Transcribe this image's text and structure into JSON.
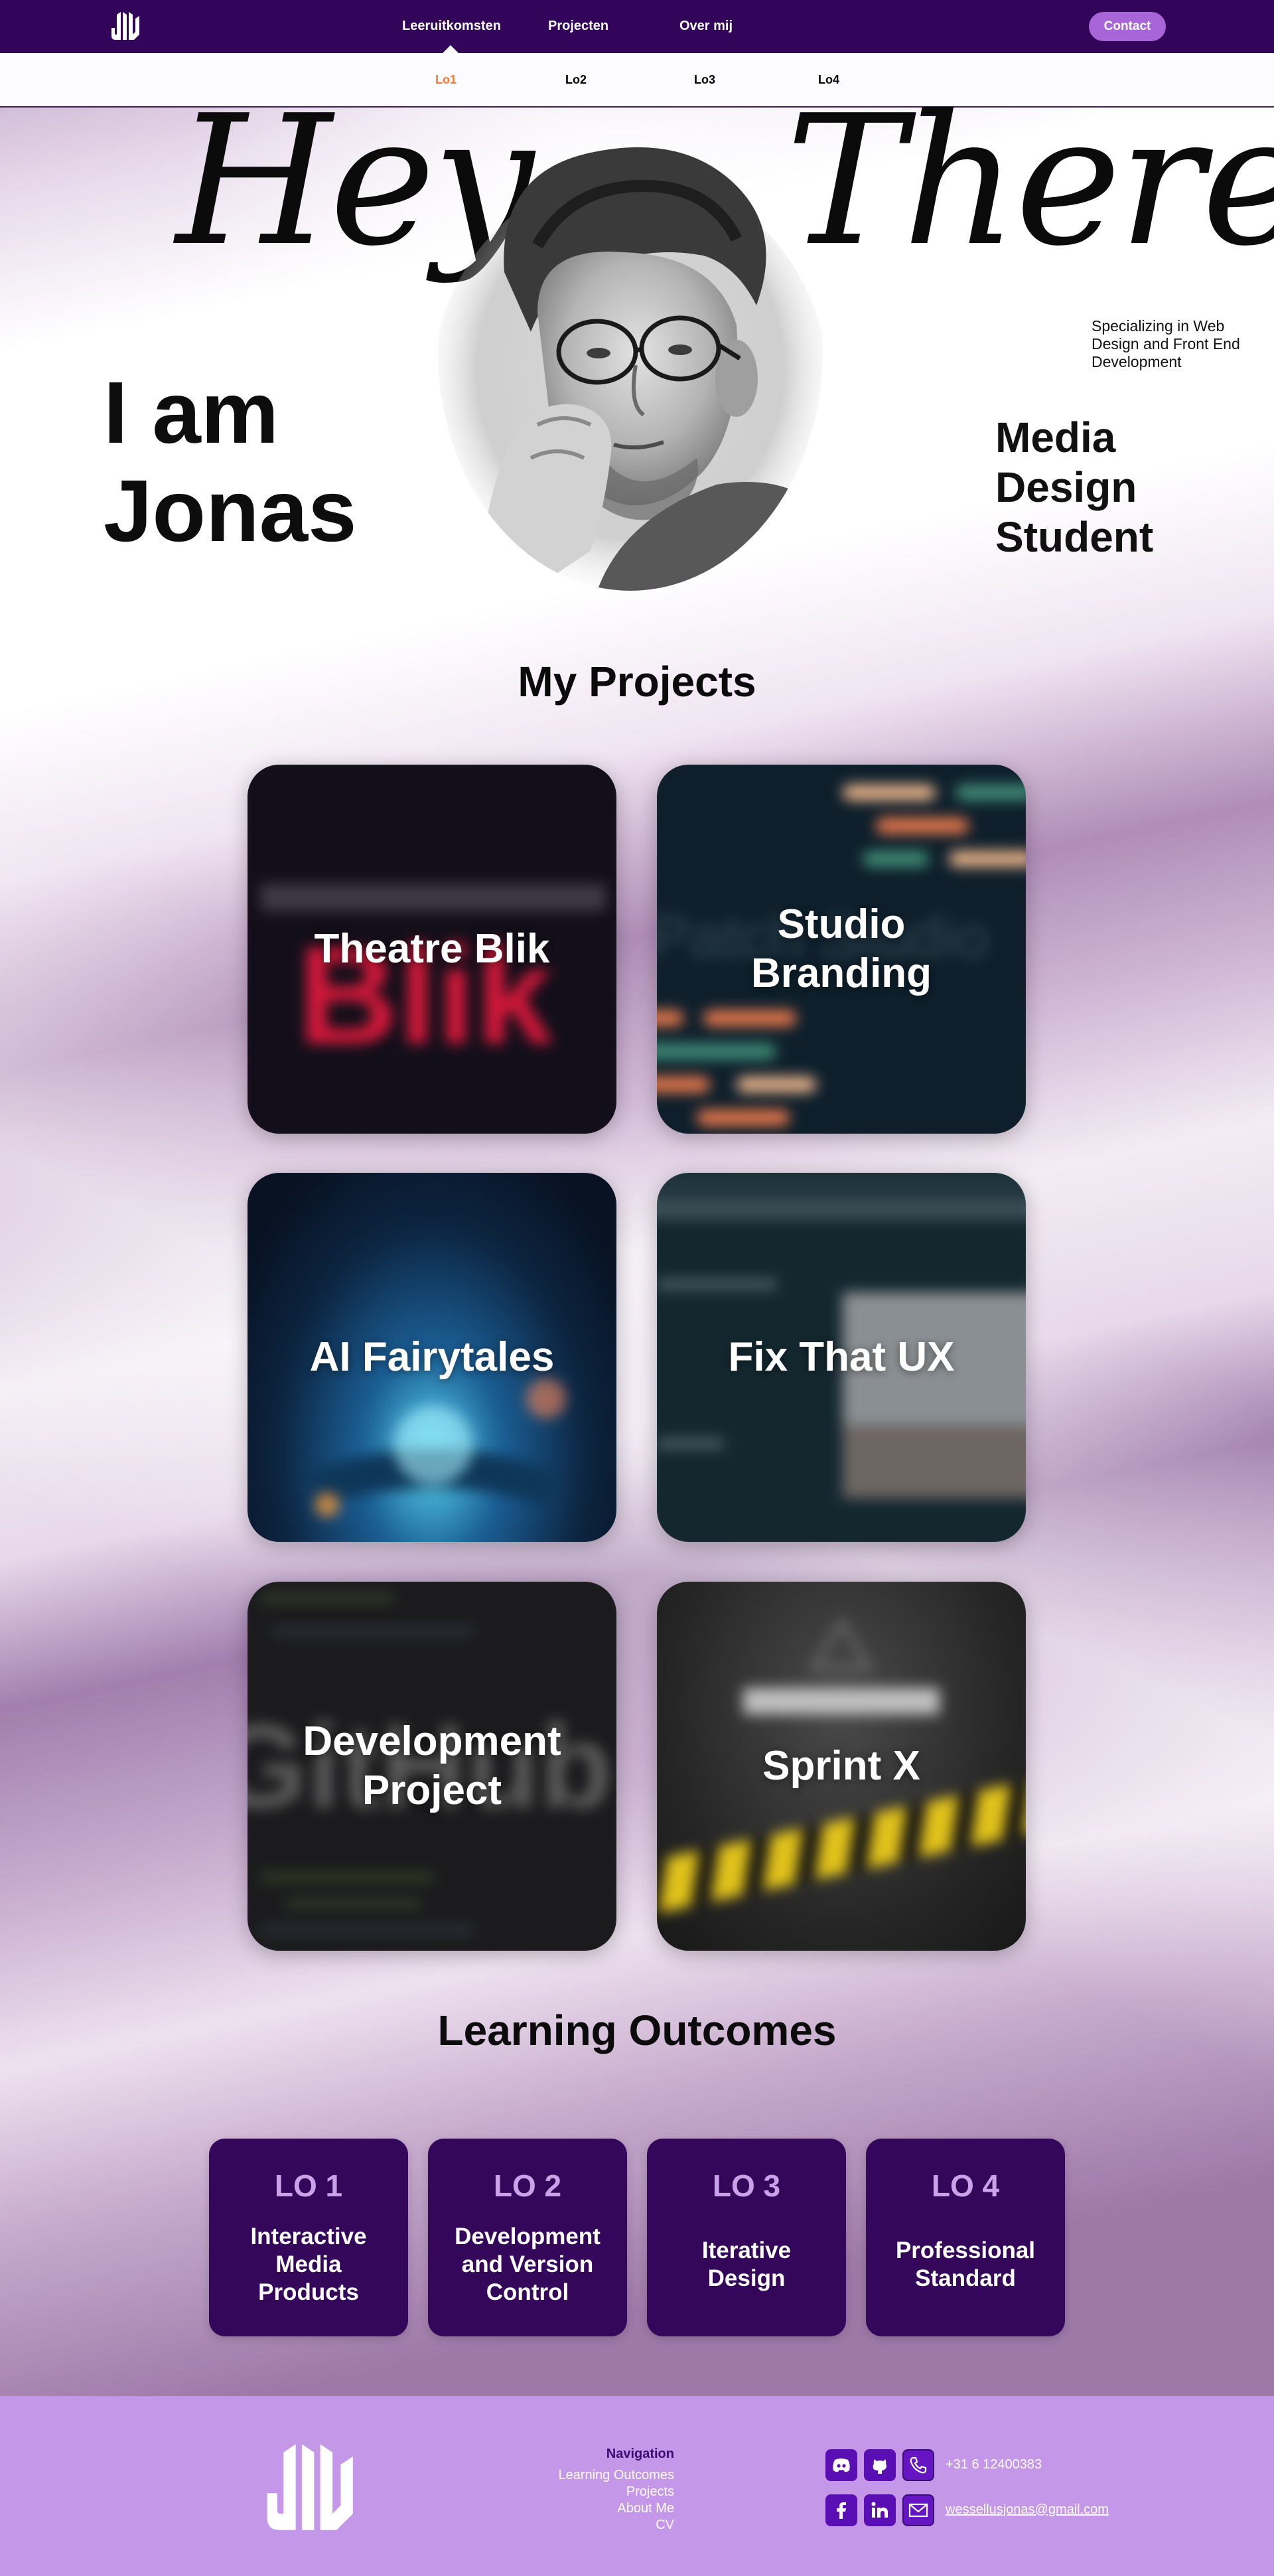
{
  "nav": {
    "items": [
      {
        "label": "Leeruitkomsten"
      },
      {
        "label": "Projecten"
      },
      {
        "label": "Over mij"
      }
    ],
    "contact_label": "Contact",
    "logo_icon": "jw-logo-icon"
  },
  "subnav": {
    "items": [
      {
        "label": "Lo1",
        "active": true
      },
      {
        "label": "Lo2"
      },
      {
        "label": "Lo3"
      },
      {
        "label": "Lo4"
      }
    ],
    "active_color": "#ef7a3a"
  },
  "hero": {
    "greeting_left": "Hey,",
    "greeting_right": "There",
    "intro": "I am Jonas",
    "speciality": "Specializing in Web Design and Front End Development",
    "role": "Media Design Student",
    "portrait_icon": "portrait-photo"
  },
  "projects": {
    "title": "My Projects",
    "items": [
      {
        "label": "Theatre Blik"
      },
      {
        "label": "Studio Branding"
      },
      {
        "label": "AI Fairytales"
      },
      {
        "label": "Fix That UX"
      },
      {
        "label": "Development Project"
      },
      {
        "label": "Sprint X"
      }
    ]
  },
  "learning_outcomes": {
    "title": "Learning Outcomes",
    "items": [
      {
        "code": "LO 1",
        "name": "Interactive Media Products"
      },
      {
        "code": "LO 2",
        "name": "Development and Version Control"
      },
      {
        "code": "LO 3",
        "name": "Iterative Design"
      },
      {
        "code": "LO 4",
        "name": "Professional Standard"
      }
    ]
  },
  "footer": {
    "nav_title": "Navigation",
    "links": [
      {
        "label": "Learning Outcomes"
      },
      {
        "label": "Projects"
      },
      {
        "label": "About Me"
      },
      {
        "label": "CV"
      }
    ],
    "phone": "+31 6 12400383",
    "email": "wessellusjonas@gmail.com",
    "social_icons": [
      "discord-icon",
      "github-icon",
      "phone-icon",
      "facebook-icon",
      "linkedin-icon",
      "mail-icon"
    ]
  },
  "colors": {
    "brand_dark": "#33055a",
    "brand_accent": "#a865d8",
    "footer_bg": "#c597e9",
    "lo_card": "#35075a"
  }
}
